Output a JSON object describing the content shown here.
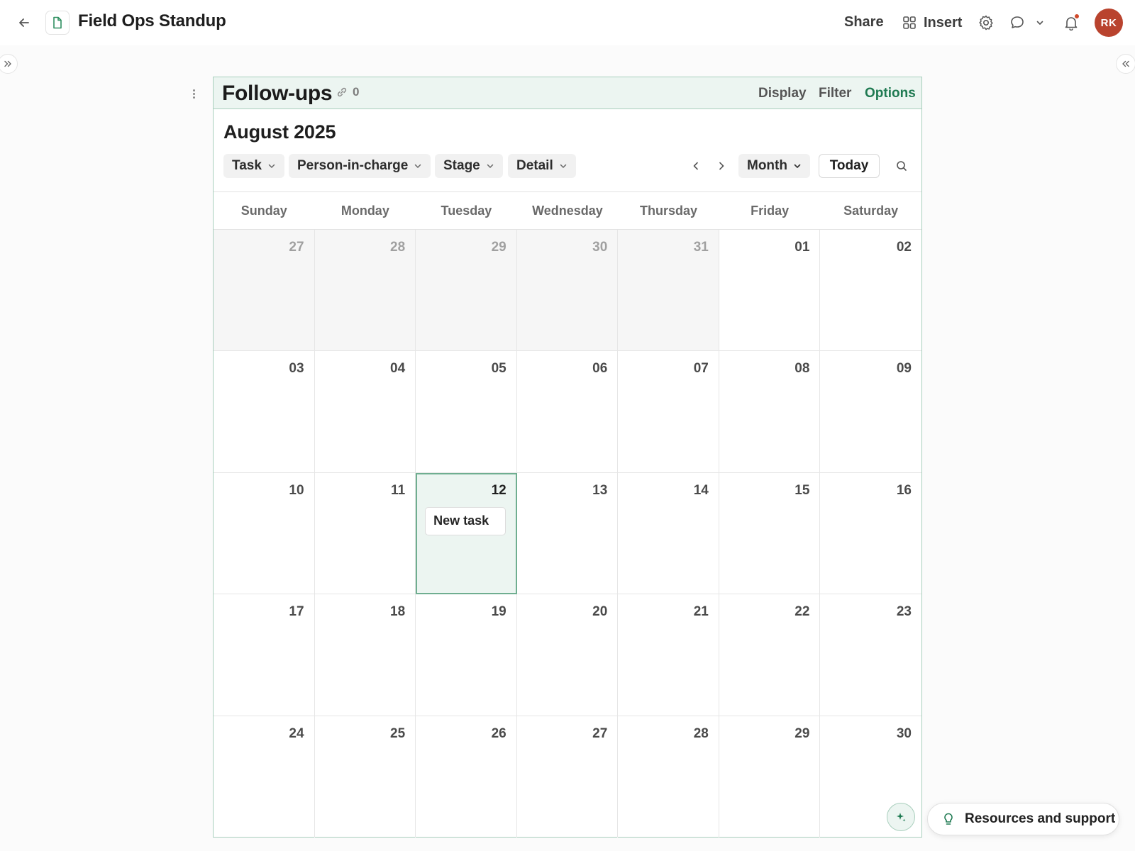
{
  "header": {
    "title": "Field Ops Standup",
    "share_label": "Share",
    "insert_label": "Insert",
    "avatar_initials": "RK"
  },
  "widget": {
    "title": "Follow-ups",
    "link_count": "0",
    "actions": {
      "display": "Display",
      "filter": "Filter",
      "options": "Options"
    },
    "month_label": "August 2025",
    "filters": [
      {
        "label": "Task"
      },
      {
        "label": "Person-in-charge"
      },
      {
        "label": "Stage"
      },
      {
        "label": "Detail"
      }
    ],
    "view_select": "Month",
    "today_label": "Today",
    "weekdays": [
      "Sunday",
      "Monday",
      "Tuesday",
      "Wednesday",
      "Thursday",
      "Friday",
      "Saturday"
    ],
    "days": [
      {
        "num": "27",
        "outside": true
      },
      {
        "num": "28",
        "outside": true
      },
      {
        "num": "29",
        "outside": true
      },
      {
        "num": "30",
        "outside": true
      },
      {
        "num": "31",
        "outside": true
      },
      {
        "num": "01",
        "outside": false
      },
      {
        "num": "02",
        "outside": false
      },
      {
        "num": "03"
      },
      {
        "num": "04"
      },
      {
        "num": "05"
      },
      {
        "num": "06"
      },
      {
        "num": "07"
      },
      {
        "num": "08"
      },
      {
        "num": "09"
      },
      {
        "num": "10"
      },
      {
        "num": "11"
      },
      {
        "num": "12",
        "selected": true,
        "task": "New task"
      },
      {
        "num": "13"
      },
      {
        "num": "14"
      },
      {
        "num": "15"
      },
      {
        "num": "16"
      },
      {
        "num": "17"
      },
      {
        "num": "18"
      },
      {
        "num": "19"
      },
      {
        "num": "20"
      },
      {
        "num": "21"
      },
      {
        "num": "22"
      },
      {
        "num": "23"
      },
      {
        "num": "24"
      },
      {
        "num": "25"
      },
      {
        "num": "26"
      },
      {
        "num": "27"
      },
      {
        "num": "28"
      },
      {
        "num": "29"
      },
      {
        "num": "30"
      }
    ]
  },
  "footer": {
    "resources_label": "Resources and support"
  },
  "colors": {
    "accent": "#1f7a52",
    "header_bg": "#ecf5f1",
    "avatar": "#b9432e"
  },
  "icons": [
    "back-arrow-icon",
    "document-icon",
    "grid-icon",
    "gear-icon",
    "comment-icon",
    "chevron-down-icon",
    "bell-icon",
    "link-icon",
    "search-icon",
    "sparkle-icon",
    "lightbulb-icon"
  ]
}
